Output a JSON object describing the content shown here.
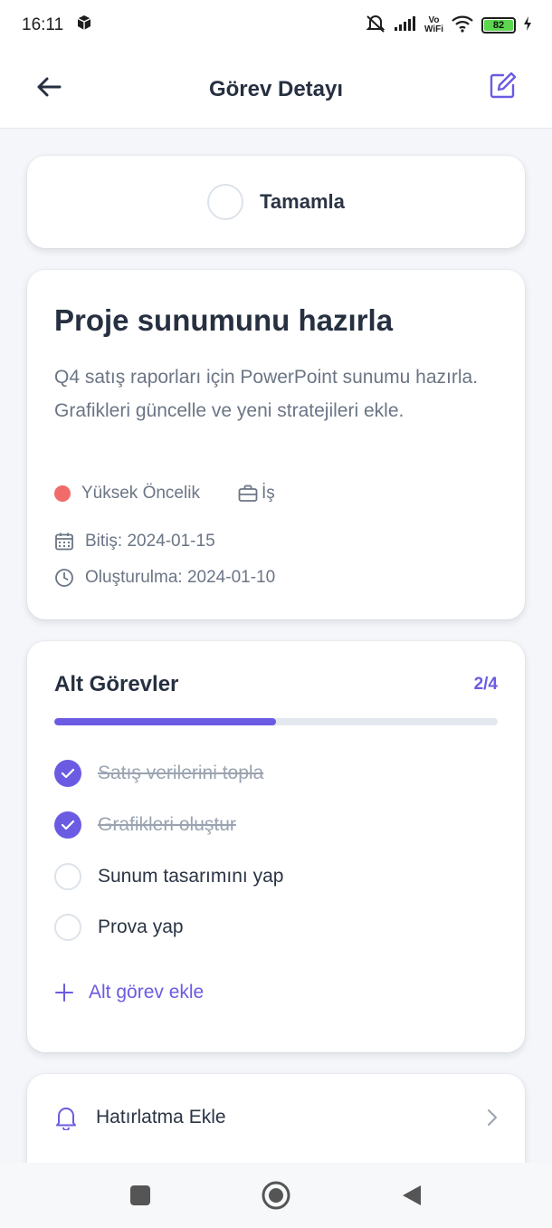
{
  "status_bar": {
    "time": "16:11",
    "vowifi_line1": "Vo",
    "vowifi_line2": "WiFi",
    "battery_level": "82"
  },
  "header": {
    "title": "Görev Detayı"
  },
  "complete": {
    "label": "Tamamla"
  },
  "task": {
    "title": "Proje sunumunu hazırla",
    "description": "Q4 satış raporları için PowerPoint sunumu hazırla. Grafikleri güncelle ve yeni stratejileri ekle.",
    "priority": "Yüksek Öncelik",
    "priority_color": "#f26b6b",
    "category": "İş",
    "due": "Bitiş: 2024-01-15",
    "created": "Oluşturulma: 2024-01-10"
  },
  "subtasks": {
    "title": "Alt Görevler",
    "count": "2/4",
    "progress_fraction": 0.5,
    "items": [
      {
        "label": "Satış verilerini topla",
        "done": true
      },
      {
        "label": "Grafikleri oluştur",
        "done": true
      },
      {
        "label": "Sunum tasarımını yap",
        "done": false
      },
      {
        "label": "Prova yap",
        "done": false
      }
    ],
    "add_label": "Alt görev ekle"
  },
  "reminder": {
    "label": "Hatırlatma Ekle"
  },
  "colors": {
    "accent": "#6a5be2"
  }
}
